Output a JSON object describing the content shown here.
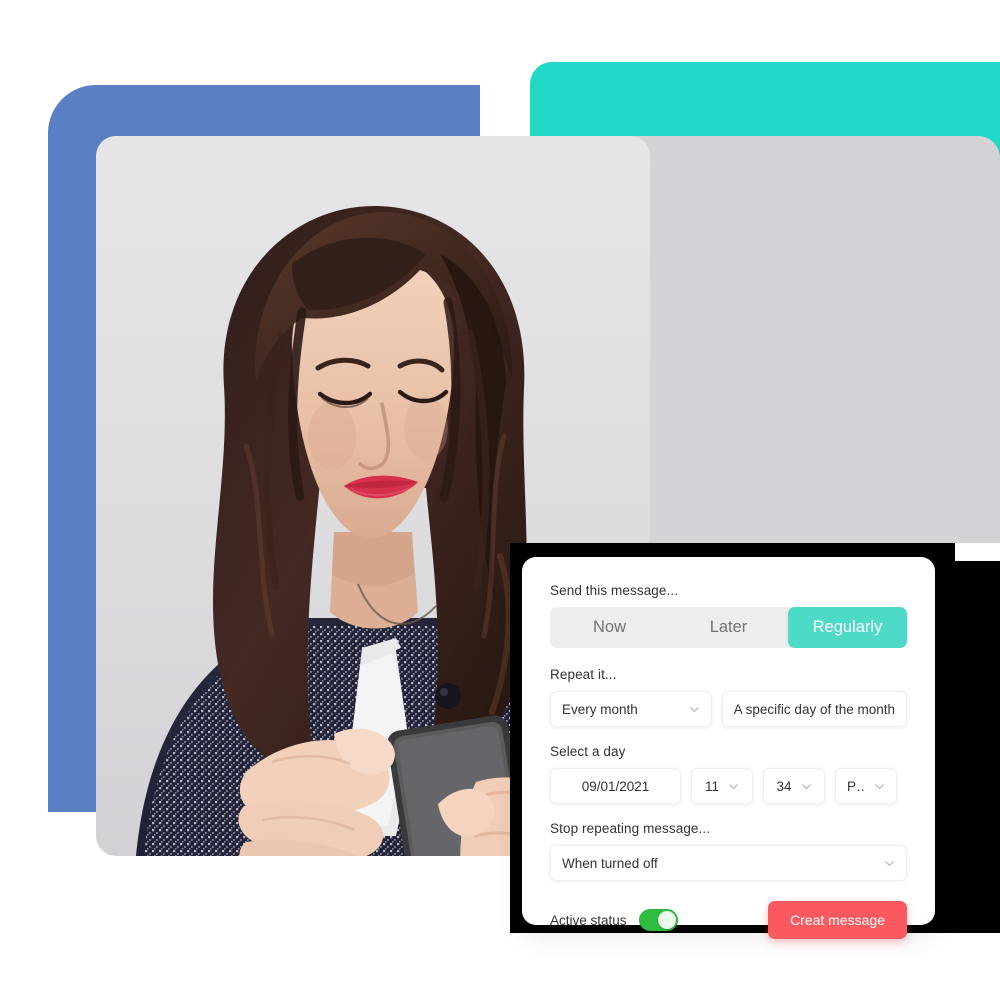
{
  "card": {
    "send_label": "Send this message...",
    "segments": [
      {
        "label": "Now",
        "active": false
      },
      {
        "label": "Later",
        "active": false
      },
      {
        "label": "Regularly",
        "active": true
      }
    ],
    "repeat_label": "Repeat it...",
    "repeat_value": "Every month",
    "repeat_mode_value": "A specific day of the month",
    "select_day_label": "Select a day",
    "date_value": "09/01/2021",
    "hour_value": "11",
    "minute_value": "34",
    "meridiem_value": "PM",
    "stop_label": "Stop repeating message...",
    "stop_value": "When turned off",
    "active_status_label": "Active status",
    "active_status_on": true,
    "cta_label": "Creat message"
  },
  "colors": {
    "accent_teal": "#4ddbc8",
    "teal_dark": "#22d9c8",
    "teal_light": "#7fefe2",
    "blue": "#5b7fc4",
    "grey_panel": "#d4d4d8",
    "black": "#000000",
    "cta_red": "#fa5a5f",
    "toggle_green": "#2fbd3f",
    "track_grey": "#ededed"
  },
  "photo": {
    "alt": "Woman with long dark wavy hair in a tweed jacket looking down at a smartphone"
  }
}
